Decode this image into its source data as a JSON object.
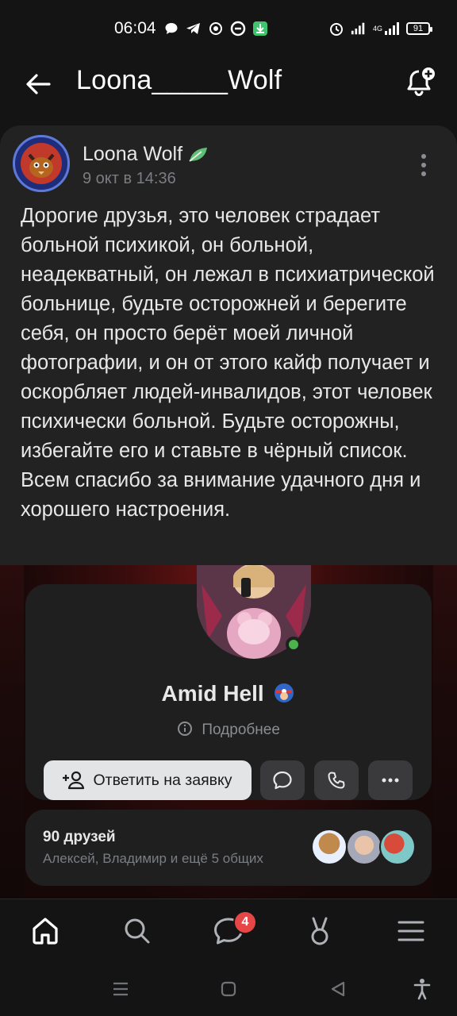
{
  "status_bar": {
    "time": "06:04",
    "network": "4G",
    "battery": "91",
    "icons": [
      "chat-bubble-icon",
      "telegram-icon",
      "vpn-icon",
      "sync-icon",
      "download-icon",
      "alarm-icon",
      "signal-icon",
      "signal-4g-icon"
    ]
  },
  "header": {
    "title": "Loona_____Wolf",
    "back_icon": "arrow-left-icon",
    "notify_icon": "bell-plus-icon"
  },
  "post": {
    "author": "Loona Wolf",
    "date": "9 окт в 14:36",
    "text": "Дорогие друзья, это человек страдает больной психикой, он больной, неадекватный, он лежал в психиатрической больнице, будьте осторожней и берегите себя, он просто берёт моей личной фотографии, и он от этого кайф получает и оскорбляет людей-инвалидов, этот человек психически больной. Будьте осторожны, избегайте его и ставьте в чёрный список. Всем спасибо за внимание удачного дня и хорошего настроения."
  },
  "profile": {
    "name": "Amid Hell",
    "more": "Подробнее",
    "answer_button": "Ответить на заявку",
    "friends_count": "90 друзей",
    "friends_mutual": "Алексей, Владимир и ещё 5 общих"
  },
  "bottom_nav": {
    "items": [
      "home-icon",
      "search-icon",
      "messages-icon",
      "clips-icon",
      "menu-icon"
    ],
    "messages_badge": "4"
  },
  "colors": {
    "background": "#141414",
    "card": "#222222",
    "badge": "#e64646",
    "online": "#4bb34b"
  }
}
